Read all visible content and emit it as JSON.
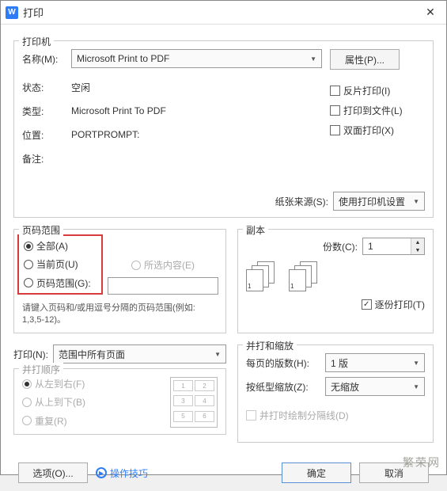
{
  "title": "打印",
  "printer": {
    "groupTitle": "打印机",
    "nameLabel": "名称(M):",
    "nameValue": "Microsoft Print to PDF",
    "propertiesBtn": "属性(P)...",
    "statusLabel": "状态:",
    "statusValue": "空闲",
    "typeLabel": "类型:",
    "typeValue": "Microsoft Print To PDF",
    "whereLabel": "位置:",
    "whereValue": "PORTPROMPT:",
    "commentLabel": "备注:",
    "commentValue": "",
    "reverseLabel": "反片打印(I)",
    "printToFileLabel": "打印到文件(L)",
    "duplexLabel": "双面打印(X)",
    "paperSourceLabel": "纸张来源(S):",
    "paperSourceValue": "使用打印机设置"
  },
  "pageRange": {
    "groupTitle": "页码范围",
    "allLabel": "全部(A)",
    "currentLabel": "当前页(U)",
    "selectionLabel": "所选内容(E)",
    "rangeLabel": "页码范围(G):",
    "rangeValue": "",
    "hint": "请键入页码和/或用逗号分隔的页码范围(例如: 1,3,5-12)。"
  },
  "copies": {
    "groupTitle": "副本",
    "copiesLabel": "份数(C):",
    "copiesValue": "1",
    "collateLabel": "逐份打印(T)"
  },
  "printWhat": {
    "label": "打印(N):",
    "value": "范围中所有页面"
  },
  "zoom": {
    "groupTitle": "并打和缩放",
    "pagesPerSheetLabel": "每页的版数(H):",
    "pagesPerSheetValue": "1 版",
    "scaleLabel": "按纸型缩放(Z):",
    "scaleValue": "无缩放",
    "drawLinesLabel": "并打时绘制分隔线(D)"
  },
  "order": {
    "groupTitle": "并打顺序",
    "ltrLabel": "从左到右(F)",
    "ttbLabel": "从上到下(B)",
    "repeatLabel": "重复(R)"
  },
  "buttons": {
    "options": "选项(O)...",
    "tips": "操作技巧",
    "ok": "确定",
    "cancel": "取消"
  },
  "watermark": "繁荣网"
}
